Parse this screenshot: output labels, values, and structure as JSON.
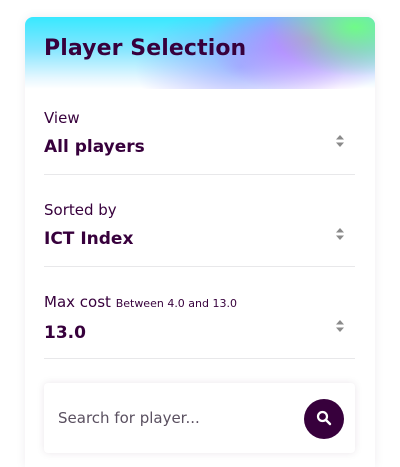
{
  "panel": {
    "title": "Player Selection"
  },
  "filters": {
    "view": {
      "label": "View",
      "value": "All players",
      "icon": "sort-arrows-icon"
    },
    "sort": {
      "label": "Sorted by",
      "value": "ICT Index",
      "icon": "sort-arrows-icon"
    },
    "max_cost": {
      "label": "Max cost",
      "range": "Between 4.0 and 13.0",
      "value": "13.0",
      "icon": "sort-arrows-icon"
    }
  },
  "search": {
    "placeholder": "Search for player...",
    "value": "",
    "icon": "search-icon"
  },
  "colors": {
    "primary": "#37003c",
    "divider": "#e8e8ea",
    "arrows": "#8a8a8a"
  }
}
